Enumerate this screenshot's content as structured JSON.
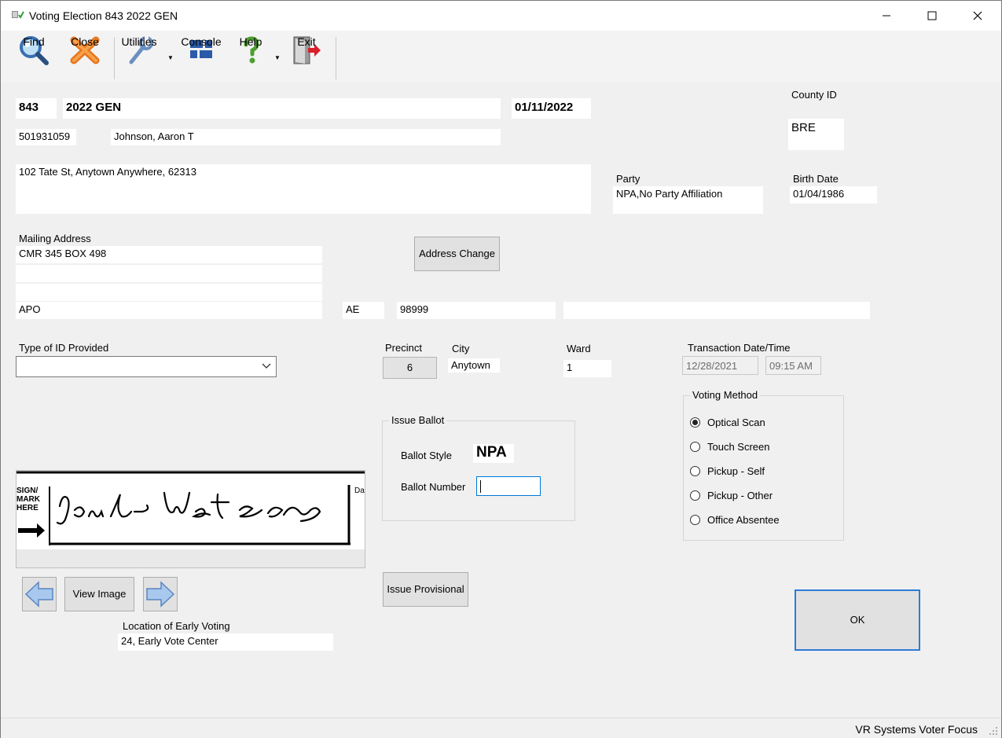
{
  "window": {
    "title": "Voting Election 843 2022 GEN"
  },
  "toolbar": {
    "find": "Find",
    "close": "Close",
    "utilities": "Utilities",
    "console": "Console",
    "help": "Help",
    "exit": "Exit"
  },
  "header": {
    "election_number": "843",
    "election_name": "2022 GEN",
    "election_date": "01/11/2022",
    "county_id_label": "County ID",
    "county_id": "BRE"
  },
  "voter": {
    "id": "501931059",
    "name": "Johnson, Aaron T",
    "address": "102 Tate St, Anytown Anywhere, 62313",
    "party_label": "Party",
    "party": "NPA,No Party Affiliation",
    "birth_date_label": "Birth Date",
    "birth_date": "01/04/1986"
  },
  "mailing": {
    "label": "Mailing Address",
    "line1": "CMR 345 BOX 498",
    "line2": "",
    "line3": "",
    "city": "APO",
    "state": "AE",
    "zip": "98999",
    "extra": "",
    "address_change_button": "Address Change"
  },
  "id_provided": {
    "label": "Type of ID Provided",
    "value": ""
  },
  "location": {
    "precinct_label": "Precinct",
    "precinct": "6",
    "city_label": "City",
    "city": "Anytown",
    "ward_label": "Ward",
    "ward": "1"
  },
  "transaction": {
    "label": "Transaction Date/Time",
    "date": "12/28/2021",
    "time": "09:15 AM"
  },
  "voting_method": {
    "label": "Voting Method",
    "options": [
      "Optical Scan",
      "Touch Screen",
      "Pickup - Self",
      "Pickup - Other",
      "Office Absentee"
    ],
    "selected": "Optical Scan"
  },
  "issue_ballot": {
    "label": "Issue Ballot",
    "style_label": "Ballot Style",
    "style": "NPA",
    "number_label": "Ballot Number",
    "number": ""
  },
  "signature": {
    "side_text": [
      "SIGN/",
      "MARK",
      "HERE"
    ],
    "edge_text": "Da"
  },
  "buttons": {
    "view_image": "View Image",
    "issue_provisional": "Issue Provisional",
    "ok": "OK"
  },
  "early_voting": {
    "label": "Location of Early Voting",
    "value": "24, Early Vote Center"
  },
  "status": {
    "text": "VR Systems Voter Focus"
  },
  "colors": {
    "focus_border": "#0078d7",
    "ok_border": "#2d7bd6"
  }
}
